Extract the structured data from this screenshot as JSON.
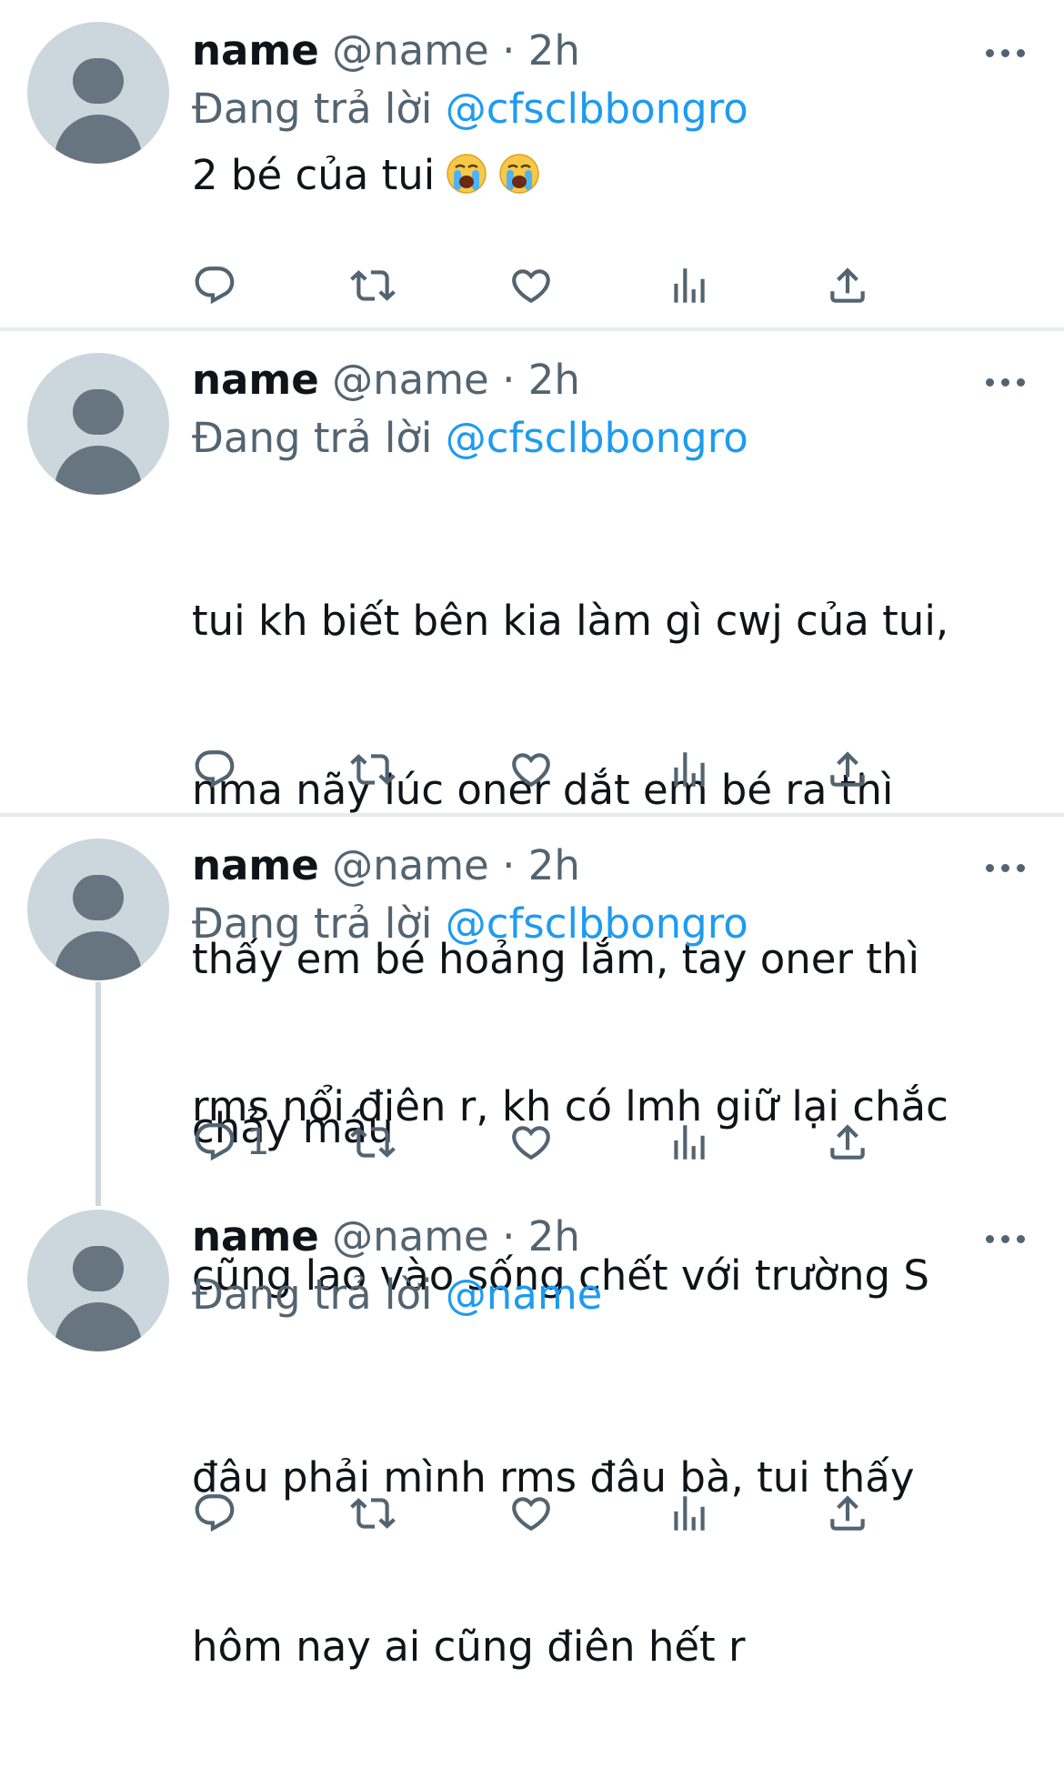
{
  "tweets": [
    {
      "name": "name",
      "handle": "@name",
      "separator": "·",
      "time": "2h",
      "reply_prefix": "Đang trả lời",
      "reply_to": "@cfsclbbongro",
      "text": "2 bé của tui",
      "emojis": [
        "loudly-crying-face",
        "loudly-crying-face"
      ],
      "reply_count": ""
    },
    {
      "name": "name",
      "handle": "@name",
      "separator": "·",
      "time": "2h",
      "reply_prefix": "Đang trả lời",
      "reply_to": "@cfsclbbongro",
      "text_lines": [
        "tui kh biết bên kia làm gì cwj của tui,",
        "nma nãy lúc oner dắt em bé ra thì",
        "thấy em bé hoảng lắm, tay oner thì",
        "chảy máu"
      ],
      "reply_count": ""
    },
    {
      "name": "name",
      "handle": "@name",
      "separator": "·",
      "time": "2h",
      "reply_prefix": "Đang trả lời",
      "reply_to": "@cfsclbbongro",
      "text_lines": [
        "rms nổi điên r, kh có lmh giữ lại chắc",
        "cũng lao vào sống chết với trường S"
      ],
      "reply_count": "1"
    },
    {
      "name": "name",
      "handle": "@name",
      "separator": "·",
      "time": "2h",
      "reply_prefix": "Đang trả lời",
      "reply_to": "@name",
      "text_lines": [
        "đâu phải mình rms đâu bà, tui thấy",
        "hôm nay ai cũng điên hết r"
      ],
      "reply_count": ""
    }
  ],
  "icons": {
    "reply": "reply-icon",
    "retweet": "retweet-icon",
    "like": "heart-icon",
    "views": "analytics-icon",
    "share": "share-icon",
    "more": "more-icon"
  },
  "colors": {
    "text": "#0f1419",
    "secondary": "#536471",
    "mention": "#1d9bf0",
    "avatar_bg": "#ccd6dd",
    "avatar_fg": "#66757f",
    "divider": "#e7ebee"
  }
}
